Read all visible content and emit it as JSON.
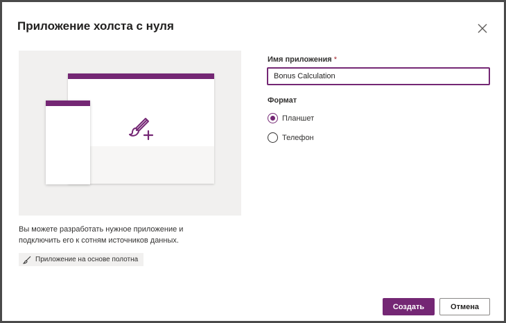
{
  "dialog": {
    "title": "Приложение холста с нуля"
  },
  "preview": {
    "description": "Вы можете разработать нужное приложение и подключить его к сотням источников данных.",
    "tag_label": "Приложение на основе полотна",
    "icon": "paintbrush-plus-icon"
  },
  "form": {
    "name_label": "Имя приложения",
    "required_marker": "*",
    "name_value": "Bonus Calculation",
    "format_label": "Формат",
    "format_options": [
      {
        "label": "Планшет",
        "selected": true
      },
      {
        "label": "Телефон",
        "selected": false
      }
    ]
  },
  "actions": {
    "create_label": "Создать",
    "cancel_label": "Отмена"
  },
  "colors": {
    "accent": "#742774",
    "preview_bg": "#f1f0ef"
  }
}
